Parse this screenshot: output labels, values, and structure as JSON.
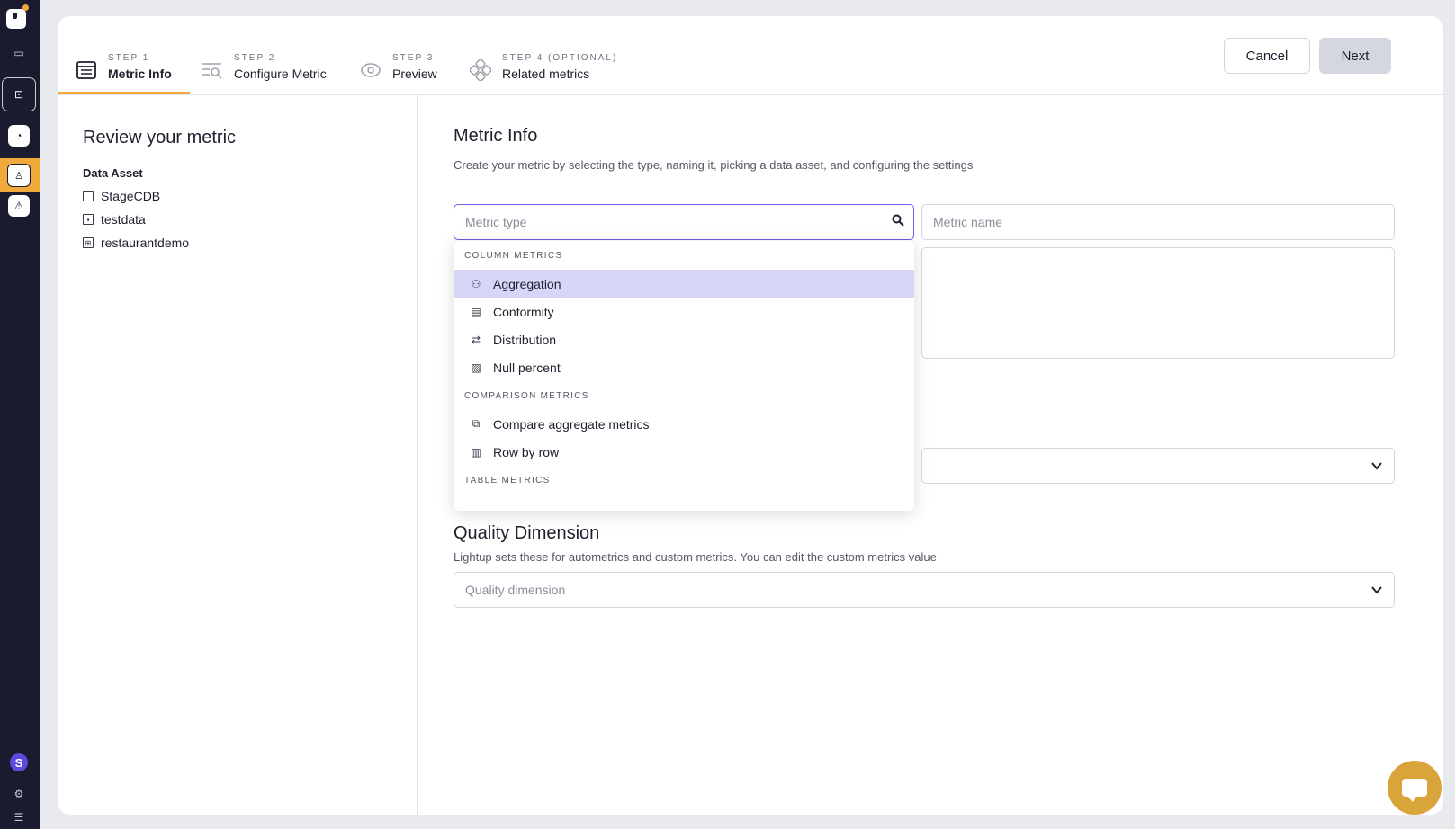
{
  "nav": {
    "items": [
      {
        "icon": "monitor-icon"
      },
      {
        "icon": "explore-icon"
      },
      {
        "icon": "dashboard-icon"
      },
      {
        "icon": "catalog-icon"
      },
      {
        "icon": "incidents-icon"
      }
    ],
    "avatar_letter": "S",
    "accent": "#f2a93b"
  },
  "stepper": {
    "steps": [
      {
        "label": "STEP 1",
        "name": "Metric Info",
        "icon": "list-icon",
        "active": true
      },
      {
        "label": "STEP 2",
        "name": "Configure Metric",
        "icon": "search-config-icon",
        "active": false
      },
      {
        "label": "STEP 3",
        "name": "Preview",
        "icon": "eye-icon",
        "active": false
      },
      {
        "label": "STEP 4 (OPTIONAL)",
        "name": "Related metrics",
        "icon": "related-icon",
        "active": false
      }
    ],
    "cancel_label": "Cancel",
    "next_label": "Next"
  },
  "review": {
    "title": "Review your metric",
    "asset_heading": "Data Asset",
    "assets": [
      {
        "name": "StageCDB",
        "icon": "database-icon"
      },
      {
        "name": "testdata",
        "icon": "schema-icon"
      },
      {
        "name": "restaurantdemo",
        "icon": "table-icon"
      }
    ]
  },
  "main": {
    "title": "Metric Info",
    "description": "Create your metric by selecting the type, naming it, picking a data asset, and configuring the settings",
    "metric_type_placeholder": "Metric type",
    "metric_name_placeholder": "Metric name",
    "quality_title": "Quality Dimension",
    "quality_description": "Lightup sets these for autometrics and custom metrics. You can edit the custom metrics value",
    "quality_placeholder": "Quality dimension"
  },
  "dropdown": {
    "groups": [
      {
        "label": "COLUMN METRICS",
        "items": [
          {
            "label": "Aggregation",
            "icon": "aggregation-icon",
            "selected": true
          },
          {
            "label": "Conformity",
            "icon": "conformity-icon",
            "selected": false
          },
          {
            "label": "Distribution",
            "icon": "distribution-icon",
            "selected": false
          },
          {
            "label": "Null percent",
            "icon": "null-percent-icon",
            "selected": false
          }
        ]
      },
      {
        "label": "COMPARISON METRICS",
        "items": [
          {
            "label": "Compare aggregate metrics",
            "icon": "compare-icon",
            "selected": false
          },
          {
            "label": "Row by row",
            "icon": "row-by-row-icon",
            "selected": false
          }
        ]
      },
      {
        "label": "TABLE METRICS",
        "items": []
      }
    ]
  }
}
